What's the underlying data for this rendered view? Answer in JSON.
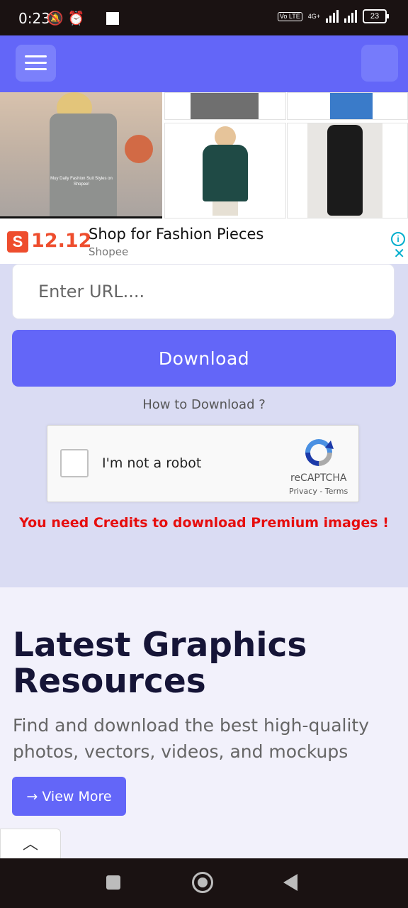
{
  "status_bar": {
    "time": "0:23",
    "icons": "🔕⏰",
    "network": "4G+",
    "volte": "Vo LTE",
    "battery": "23"
  },
  "header": {
    "menu_icon": "hamburger-icon"
  },
  "ad": {
    "photo_caption": "Muy Daily Fashion Suit Styles on Shopee!",
    "promo": "12.12",
    "logo_letter": "S",
    "title": "Shop for Fashion Pieces",
    "subtitle": "Shopee",
    "info_icon": "i",
    "close_icon": "✕"
  },
  "form": {
    "url_placeholder": "Enter URL....",
    "download_label": "Download",
    "howto_label": "How to Download ?"
  },
  "captcha": {
    "label": "I'm not a robot",
    "brand": "reCAPTCHA",
    "links": "Privacy - Terms"
  },
  "warning": "You need Credits to download Premium images !",
  "latest": {
    "title": "Latest Graphics Resources",
    "description": "Find and download the best high-quality photos, vectors, videos, and mockups",
    "view_more_label": "→ View More"
  },
  "scroll_top_icon": "︿"
}
